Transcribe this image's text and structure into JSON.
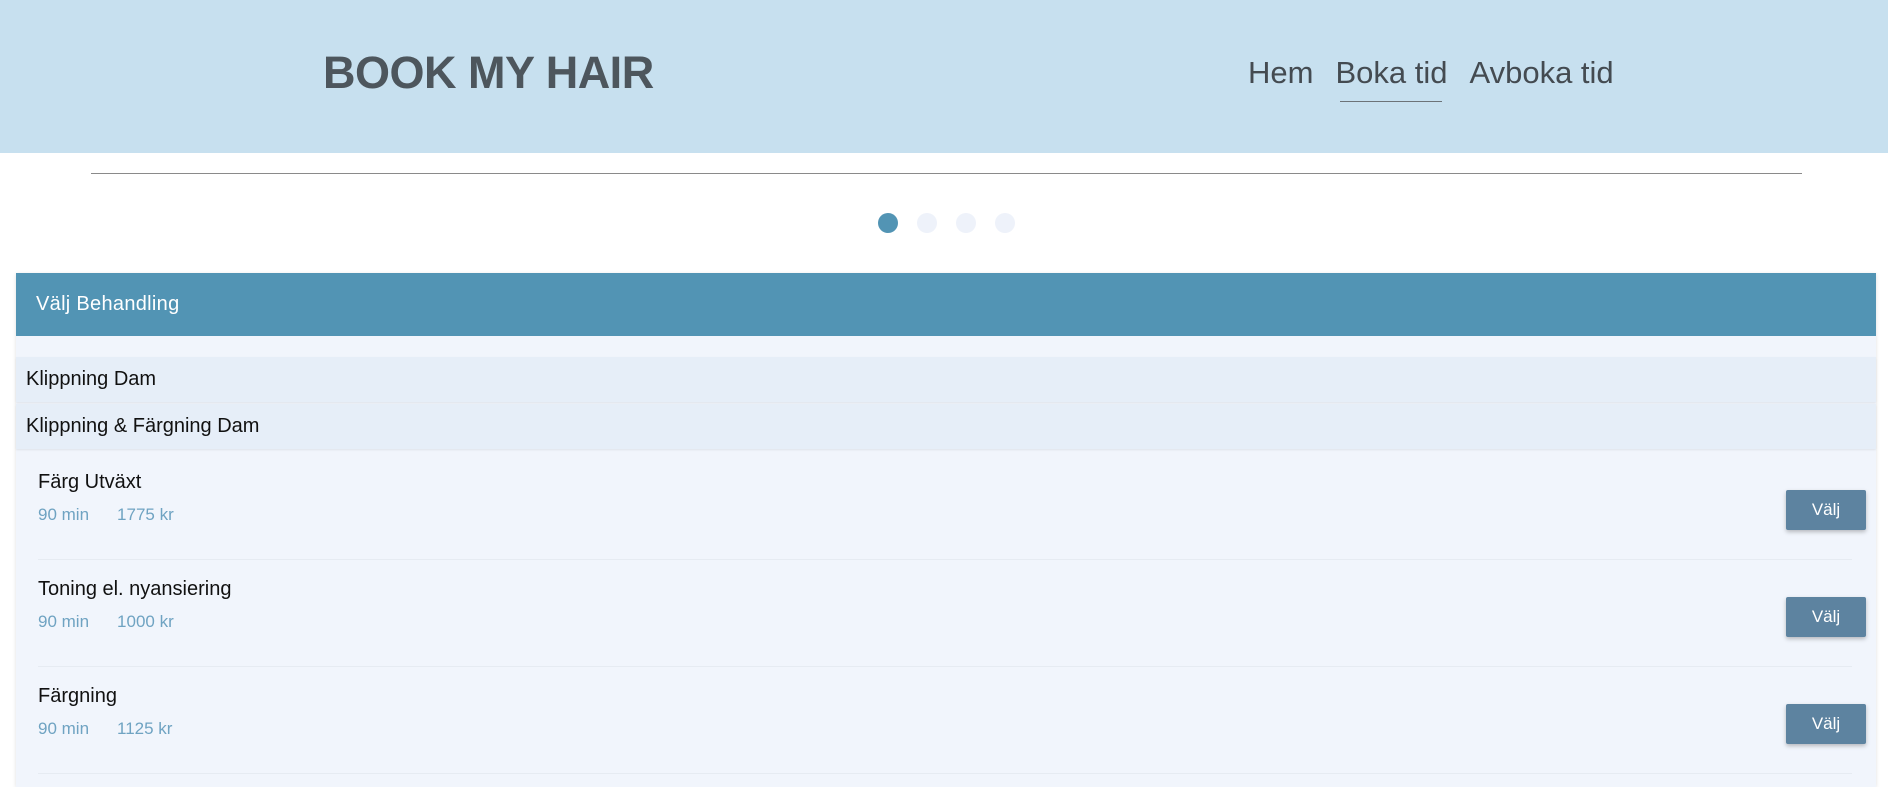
{
  "header": {
    "brand": "BOOK MY HAIR",
    "nav": [
      {
        "label": "Hem"
      },
      {
        "label": "Boka tid"
      },
      {
        "label": "Avboka tid"
      }
    ],
    "active_nav": "Boka tid"
  },
  "steps": {
    "total": 4,
    "current": 1
  },
  "panel": {
    "title": "Välj Behandling",
    "categories": [
      {
        "label": "Klippning Dam"
      },
      {
        "label": "Klippning & Färgning Dam"
      }
    ],
    "treatments": [
      {
        "name": "Färg Utväxt",
        "duration": "90 min",
        "price": "1775 kr",
        "button": "Välj"
      },
      {
        "name": "Toning el. nyansiering",
        "duration": "90 min",
        "price": "1000 kr",
        "button": "Välj"
      },
      {
        "name": "Färgning",
        "duration": "90 min",
        "price": "1125 kr",
        "button": "Välj"
      }
    ]
  },
  "colors": {
    "header_bg": "#c7e0ef",
    "accent": "#5294b4",
    "button": "#5d83a0",
    "meta_text": "#6fa3c2"
  }
}
